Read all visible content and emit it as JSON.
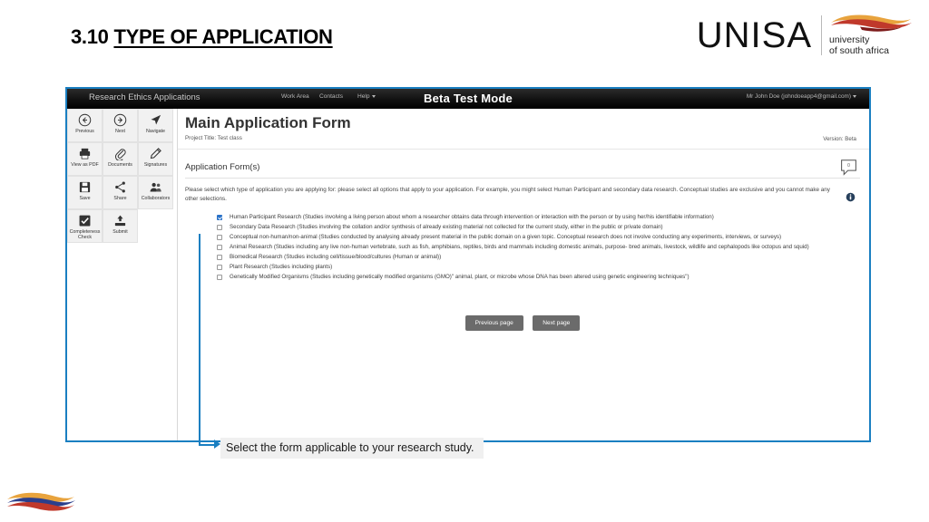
{
  "slide": {
    "number": "3.10",
    "title": "TYPE OF APPLICATION"
  },
  "logo": {
    "wordmark": "UNISA",
    "sub_line1": "university",
    "sub_line2": "of south africa"
  },
  "appbar": {
    "brand": "Research Ethics Applications",
    "nav": [
      {
        "label": "Work Area"
      },
      {
        "label": "Contacts"
      },
      {
        "label": "Help"
      }
    ],
    "center_title": "Beta Test Mode",
    "user": "Mr John Doe (johndoeapp4@gmail.com)"
  },
  "rail": {
    "tools": [
      {
        "label": "Previous",
        "icon": "arrow-left-circle-icon"
      },
      {
        "label": "Next",
        "icon": "arrow-right-circle-icon"
      },
      {
        "label": "Navigate",
        "icon": "navigate-arrow-icon"
      },
      {
        "label": "View as PDF",
        "icon": "printer-icon"
      },
      {
        "label": "Documents",
        "icon": "paperclip-icon"
      },
      {
        "label": "Signatures",
        "icon": "pencil-icon"
      },
      {
        "label": "Save",
        "icon": "floppy-disk-icon"
      },
      {
        "label": "Share",
        "icon": "share-nodes-icon"
      },
      {
        "label": "Collaborators",
        "icon": "people-icon"
      },
      {
        "label": "Completeness Check",
        "icon": "checkbox-tick-icon"
      },
      {
        "label": "Submit",
        "icon": "upload-icon"
      }
    ]
  },
  "form": {
    "title": "Main Application Form",
    "project_title": "Project Title: Test class",
    "version": "Version: Beta",
    "section_title": "Application Form(s)",
    "comment_count": "0",
    "instructions": "Please select which type of application you are applying for: please select all options that apply to your application. For example, you might select Human Participant and secondary data research. Conceptual studies are exclusive and you cannot make any other selections.",
    "options": [
      {
        "checked": true,
        "label": "Human Participant Research (Studies involving a living person about whom a researcher obtains data through intervention or interaction with the person or by using her/his identifiable information)"
      },
      {
        "checked": false,
        "label": "Secondary Data Research (Studies involving the collation and/or synthesis of already existing material not collected for the current study, either in the public or private domain)"
      },
      {
        "checked": false,
        "label": "Conceptual non-human/non-animal (Studies conducted by analysing already present material in the public domain on a given topic. Conceptual research does not involve conducting any experiments, interviews, or surveys)"
      },
      {
        "checked": false,
        "label": "Animal Research (Studies including any live non-human vertebrate, such as fish, amphibians, reptiles, birds and mammals including domestic animals, purpose- bred animals, livestock, wildlife and cephalopods like octopus and squid)"
      },
      {
        "checked": false,
        "label": "Biomedical Research (Studies including cell/tissue/blood/cultures (Human or animal))"
      },
      {
        "checked": false,
        "label": "Plant Research (Studies including plants)"
      },
      {
        "checked": false,
        "label": "Genetically Modified Organisms (Studies including genetically modified organisms (GMO)\" animal, plant, or microbe whose DNA has been altered using genetic engineering techniques\")"
      }
    ],
    "pager": {
      "previous": "Previous page",
      "next": "Next page"
    }
  },
  "annotation": {
    "caption": "Select the form applicable to your research study."
  },
  "colors": {
    "accent_blue": "#1a7fc1",
    "checkbox_checked": "#2a72c8",
    "appbar_black": "#000000",
    "button_grey": "#6b6b6b"
  }
}
